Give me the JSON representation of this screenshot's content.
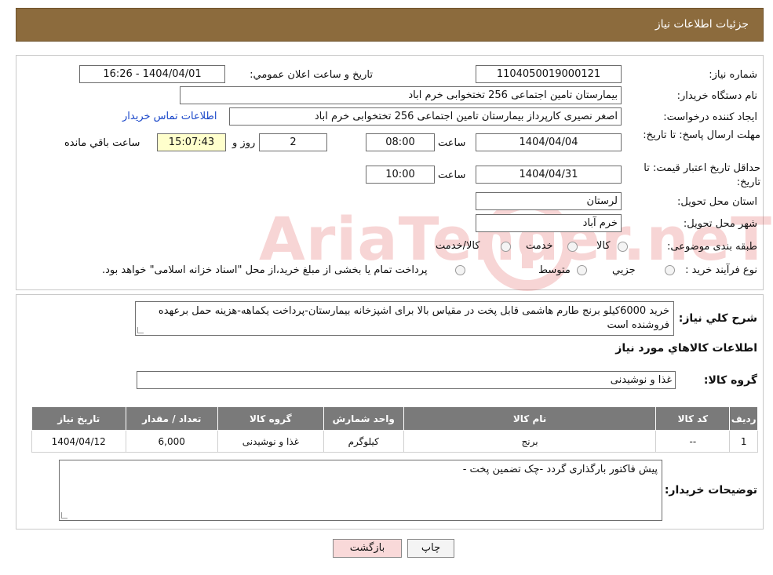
{
  "header": {
    "title": "جزئیات اطلاعات نیاز"
  },
  "fields": {
    "need_number_label": "شماره نیاز:",
    "need_number": "1104050019000121",
    "announce_label": "تاريخ و ساعت اعلان عمومي:",
    "announce_value": "1404/04/01 - 16:26",
    "buyer_org_label": "نام دستگاه خريدار:",
    "buyer_org": "بیمارستان تامین اجتماعی  256 تختخوابی خرم اباد",
    "creator_label": "ايجاد کننده درخواست:",
    "creator": "اصغر نصیری کارپرداز بیمارستان تامین اجتماعی  256 تختخوابی خرم اباد",
    "contact_link": "اطلاعات تماس خريدار",
    "deadline_label": "مهلت ارسال پاسخ: تا تاريخ:",
    "deadline_date": "1404/04/04",
    "time_label": "ساعت",
    "deadline_time": "08:00",
    "days_value": "2",
    "days_label": "روز و",
    "remaining_time": "15:07:43",
    "remaining_label": "ساعت باقي مانده",
    "validity_label": "حداقل تاريخ اعتبار قيمت: تا تاريخ:",
    "validity_date": "1404/04/31",
    "validity_time": "10:00",
    "province_label": "استان محل تحويل:",
    "province": "لرستان",
    "city_label": "شهر محل تحويل:",
    "city": "خرم آباد",
    "category_label": "طبقه بندی موضوعی:",
    "category_options": [
      "کالا",
      "خدمت",
      "کالا/خدمت"
    ],
    "process_label": "نوع فرآيند خريد :",
    "process_options": [
      "جزيي",
      "متوسط"
    ],
    "process_note": "پرداخت تمام یا بخشی از مبلغ خرید،از محل \"اسناد خزانه اسلامی\" خواهد بود."
  },
  "summary": {
    "label": "شرح کلي نياز:",
    "text": "خرید 6000کیلو برنج طارم هاشمی قابل پخت در مقیاس بالا برای اشپزخانه بیمارستان-پرداخت یکماهه-هزینه حمل برعهده فروشنده است",
    "goods_info_title": "اطلاعات کالاهاي مورد نياز",
    "goods_group_label": "گروه کالا:",
    "goods_group": "غذا و نوشیدنی"
  },
  "table": {
    "headers": [
      "رديف",
      "کد کالا",
      "نام کالا",
      "واحد شمارش",
      "گروه کالا",
      "تعداد / مقدار",
      "تاريخ نياز"
    ],
    "rows": [
      [
        "1",
        "--",
        "برنج",
        "کیلوگرم",
        "غذا و نوشیدنی",
        "6,000",
        "1404/04/12"
      ]
    ]
  },
  "buyer_notes": {
    "label": "توضيحات خريدار:",
    "text": "پیش فاکتور بارگذاری گردد -چک تضمین پخت -"
  },
  "buttons": {
    "print": "چاپ",
    "back": "بازگشت"
  },
  "watermark": {
    "text": "AriaTender.neT"
  },
  "colors": {
    "header_bg": "#8c6b3d",
    "table_header_bg": "#7a7a7a",
    "back_button_bg": "#f9d9d9",
    "link": "#1a47c9"
  }
}
